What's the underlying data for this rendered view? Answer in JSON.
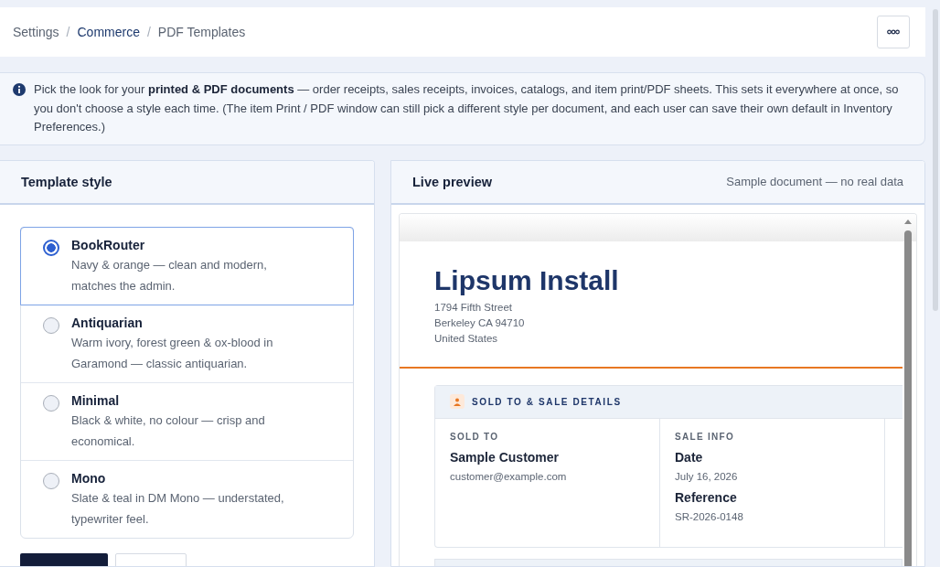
{
  "breadcrumb": [
    {
      "label": "Settings",
      "kind": "text"
    },
    {
      "label": "/",
      "kind": "separator"
    },
    {
      "label": "Commerce",
      "kind": "link"
    },
    {
      "label": "/",
      "kind": "separator"
    },
    {
      "label": "PDF Templates",
      "kind": "current"
    }
  ],
  "notice": {
    "text": "Pick the look for your **printed & PDF documents** — order receipts, sales receipts, invoices, catalogs, and item print/PDF sheets. This sets it everywhere at once, so you don't choose a style each time. (The item Print / PDF window can still pick a different style per document, and each user can save their own default in Inventory Preferences.)"
  },
  "template_panel": {
    "title": "Template style",
    "options": [
      {
        "name": "BookRouter",
        "description": "Navy & orange — clean and modern, matches the admin.",
        "selected": true
      },
      {
        "name": "Antiquarian",
        "description": "Warm ivory, forest green & ox-blood in Garamond — classic antiquarian.",
        "selected": false
      },
      {
        "name": "Minimal",
        "description": "Black & white, no colour — crisp and economical.",
        "selected": false
      },
      {
        "name": "Mono",
        "description": "Slate & teal in DM Mono — understated, typewriter feel.",
        "selected": false
      }
    ],
    "actions": [
      {
        "kind": "primary"
      },
      {
        "kind": "secondary"
      }
    ]
  },
  "preview_panel": {
    "title": "Live preview",
    "note": "Sample document — no real data",
    "document": {
      "company": "Lipsum Install",
      "address": [
        "1794 Fifth Street",
        "Berkeley CA 94710",
        "United States"
      ],
      "section": {
        "title": "SOLD TO & SALE DETAILS",
        "columns": [
          {
            "heading": "SOLD TO",
            "fields": [
              {
                "label": "Sample Customer",
                "value": "customer@example.com"
              }
            ]
          },
          {
            "heading": "SALE INFO",
            "fields": [
              {
                "label": "Date",
                "value": "July 16, 2026"
              },
              {
                "label": "Reference",
                "value": "SR-2026-0148"
              }
            ]
          }
        ]
      }
    }
  }
}
